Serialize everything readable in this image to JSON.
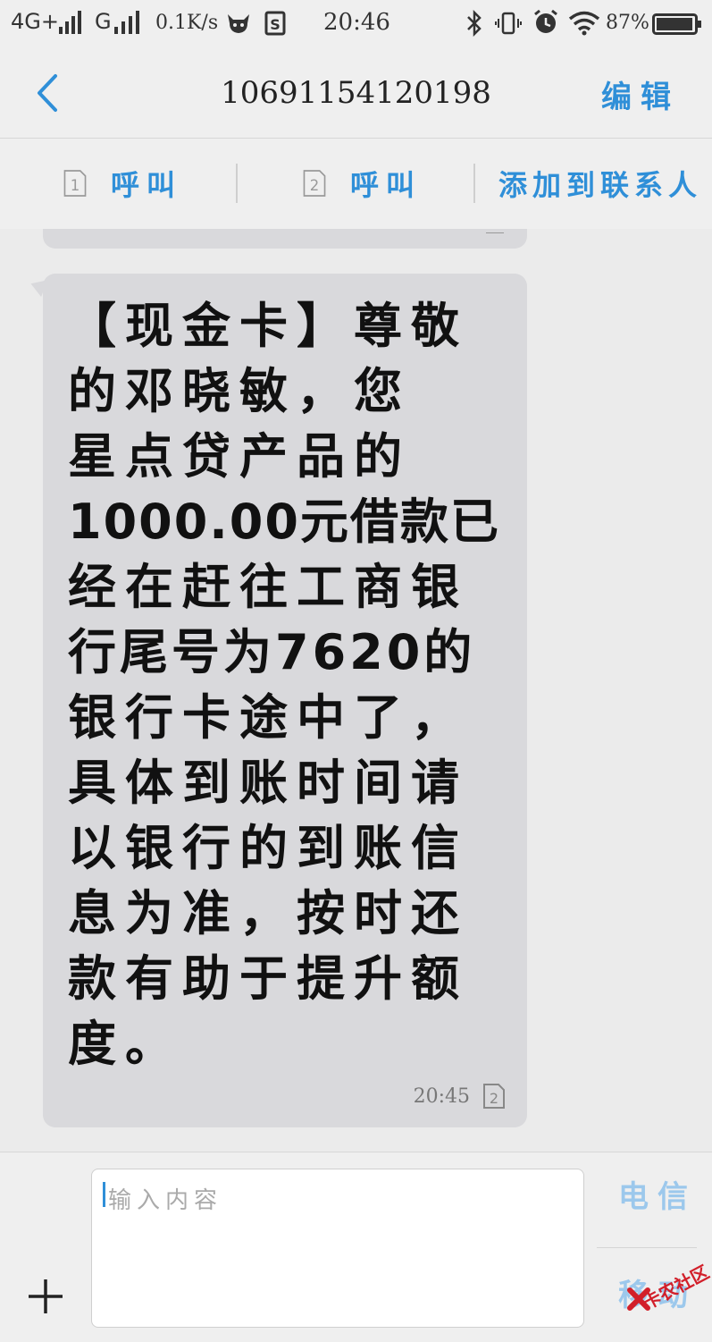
{
  "status_bar": {
    "network1": "4G+",
    "network2": "G",
    "speed": "0.1K/s",
    "time": "20:46",
    "battery": "87%"
  },
  "nav": {
    "title": "10691154120198",
    "edit_label": "编辑"
  },
  "actions": {
    "call1_sim": "1",
    "call1_label": "呼叫",
    "call2_sim": "2",
    "call2_label": "呼叫",
    "add_contact_label": "添加到联系人"
  },
  "message": {
    "text": "【现金卡】尊敬的邓晓敏，您星点贷产品的1000.00元借款已经在赶往工商银行尾号为7620的银行卡途中了，具体到账时间请以银行的到账信息为准，按时还款有助于提升额度。",
    "lines": [
      "【现金卡】尊敬",
      "的邓晓敏，您",
      "星点贷产品的",
      "1000.00元借款已",
      "经在赶往工商银",
      "行尾号为7620的",
      "银行卡途中了，",
      "具体到账时间请",
      "以银行的到账信",
      "息为准，按时还",
      "款有助于提升额",
      "度。"
    ],
    "time": "20:45",
    "sim": "2"
  },
  "composer": {
    "placeholder": "输入内容",
    "carrier1": "电信",
    "carrier2": "移动"
  },
  "watermark": {
    "text": "卡农社区"
  },
  "colors": {
    "accent": "#2f8fd8",
    "bubble": "#d9d9dc",
    "background": "#ebebeb"
  }
}
